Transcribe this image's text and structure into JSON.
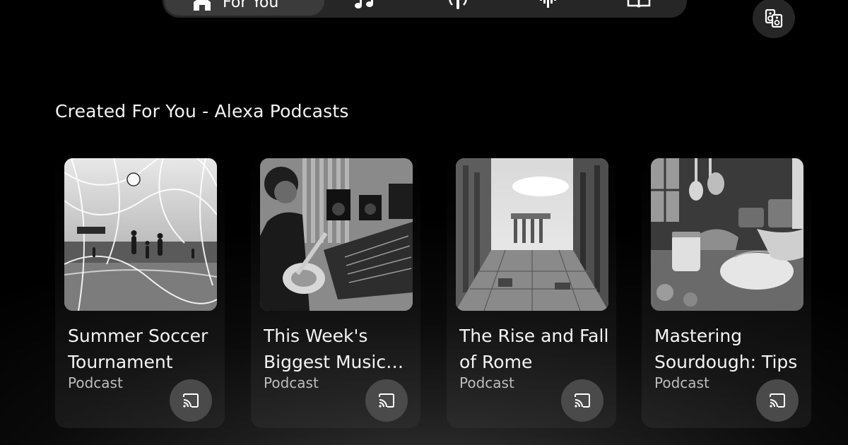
{
  "nav": {
    "tabs": [
      {
        "label": "For You",
        "icon": "home-icon",
        "active": true
      },
      {
        "label": "",
        "icon": "music-note-icon",
        "active": false
      },
      {
        "label": "",
        "icon": "podcast-icon",
        "active": false
      },
      {
        "label": "",
        "icon": "audio-waveform-icon",
        "active": false
      },
      {
        "label": "",
        "icon": "book-icon",
        "active": false
      }
    ],
    "devices_icon": "speakers-icon"
  },
  "section": {
    "title": "Created For You - Alexa Podcasts"
  },
  "cards": [
    {
      "title": "Summer Soccer Tournament",
      "subtitle": "Podcast",
      "art": "soccer-net-goal-image"
    },
    {
      "title": "This Week's Biggest Music News",
      "subtitle": "Podcast",
      "art": "guitarist-studio-image"
    },
    {
      "title": "The Rise and Fall of Rome",
      "subtitle": "Podcast",
      "art": "roman-ruins-image"
    },
    {
      "title": "Mastering Sourdough: Tips",
      "subtitle": "Podcast",
      "art": "sourdough-kitchen-image"
    }
  ],
  "colors": {
    "background": "#000000",
    "pill": "#262626",
    "active_pill": "#3b3b3b",
    "cast_button": "#4a4a4a",
    "text": "#f4f4f4",
    "subtext": "#bdbdbd"
  }
}
